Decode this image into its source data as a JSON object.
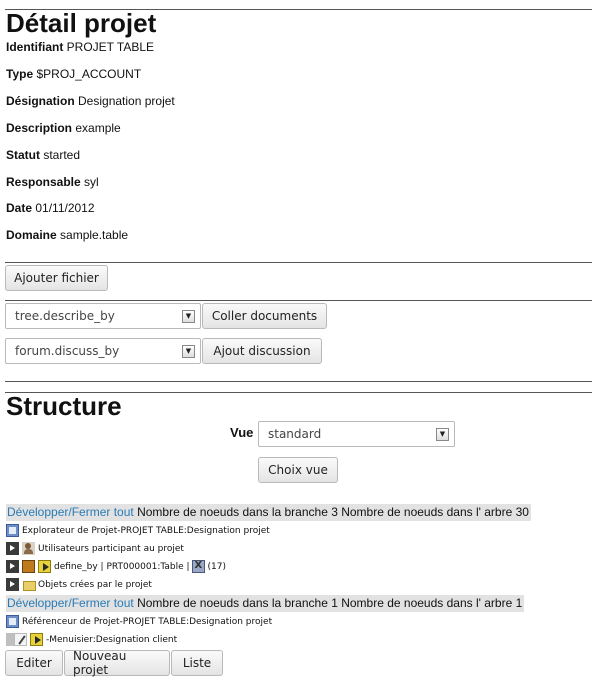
{
  "detail": {
    "title": "Détail projet",
    "fields": [
      {
        "label": "Identifiant",
        "value": "PROJET TABLE"
      },
      {
        "label": "Type",
        "value": "$PROJ_ACCOUNT"
      },
      {
        "label": "Désignation",
        "value": "Designation projet"
      },
      {
        "label": "Description",
        "value": "example"
      },
      {
        "label": "Statut",
        "value": "started"
      },
      {
        "label": "Responsable",
        "value": "syl"
      },
      {
        "label": "Date",
        "value": "01/11/2012"
      },
      {
        "label": "Domaine",
        "value": "sample.table"
      }
    ],
    "add_file_label": "Ajouter fichier"
  },
  "documents": {
    "describe_select": "tree.describe_by",
    "paste_label": "Coller documents",
    "discuss_select": "forum.discuss_by",
    "add_discussion_label": "Ajout discussion"
  },
  "structure": {
    "title": "Structure",
    "vue_label": "Vue",
    "vue_value": "standard",
    "choose_view_label": "Choix vue",
    "tree1": {
      "toggle_label": "Développer/Fermer tout",
      "stats": " Nombre de noeuds dans la branche 3 Nombre de noeuds dans l' arbre 30",
      "root": "Explorateur de Projet-PROJET TABLE:Designation projet",
      "nodes": [
        "Utilisateurs participant au projet",
        "define_by | PRT000001:Table | ",
        "(17)",
        "Objets crées par le projet"
      ]
    },
    "tree2": {
      "toggle_label": "Développer/Fermer tout",
      "stats": " Nombre de noeuds dans la branche 1 Nombre de noeuds dans l' arbre 1",
      "root": "Référenceur de Projet-PROJET TABLE:Designation projet",
      "nodes": [
        "-Menuisier:Designation client"
      ]
    }
  },
  "actions": {
    "edit_label": "Editer",
    "new_project_label": "Nouveau projet",
    "list_label": "Liste"
  }
}
